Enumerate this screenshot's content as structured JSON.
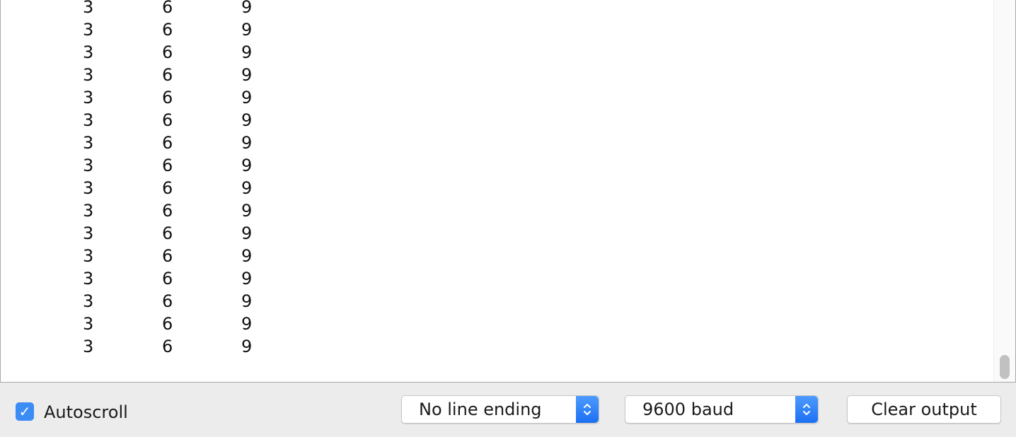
{
  "output": {
    "rows": [
      [
        "3",
        "6",
        "9"
      ],
      [
        "3",
        "6",
        "9"
      ],
      [
        "3",
        "6",
        "9"
      ],
      [
        "3",
        "6",
        "9"
      ],
      [
        "3",
        "6",
        "9"
      ],
      [
        "3",
        "6",
        "9"
      ],
      [
        "3",
        "6",
        "9"
      ],
      [
        "3",
        "6",
        "9"
      ],
      [
        "3",
        "6",
        "9"
      ],
      [
        "3",
        "6",
        "9"
      ],
      [
        "3",
        "6",
        "9"
      ],
      [
        "3",
        "6",
        "9"
      ],
      [
        "3",
        "6",
        "9"
      ],
      [
        "3",
        "6",
        "9"
      ],
      [
        "3",
        "6",
        "9"
      ],
      [
        "3",
        "6",
        "9"
      ]
    ]
  },
  "footer": {
    "autoscroll_label": "Autoscroll",
    "autoscroll_checked": true,
    "line_ending_value": "No line ending",
    "baud_value": "9600 baud",
    "clear_label": "Clear output"
  },
  "colors": {
    "accent": "#3b8cf5",
    "background": "#ececec"
  }
}
